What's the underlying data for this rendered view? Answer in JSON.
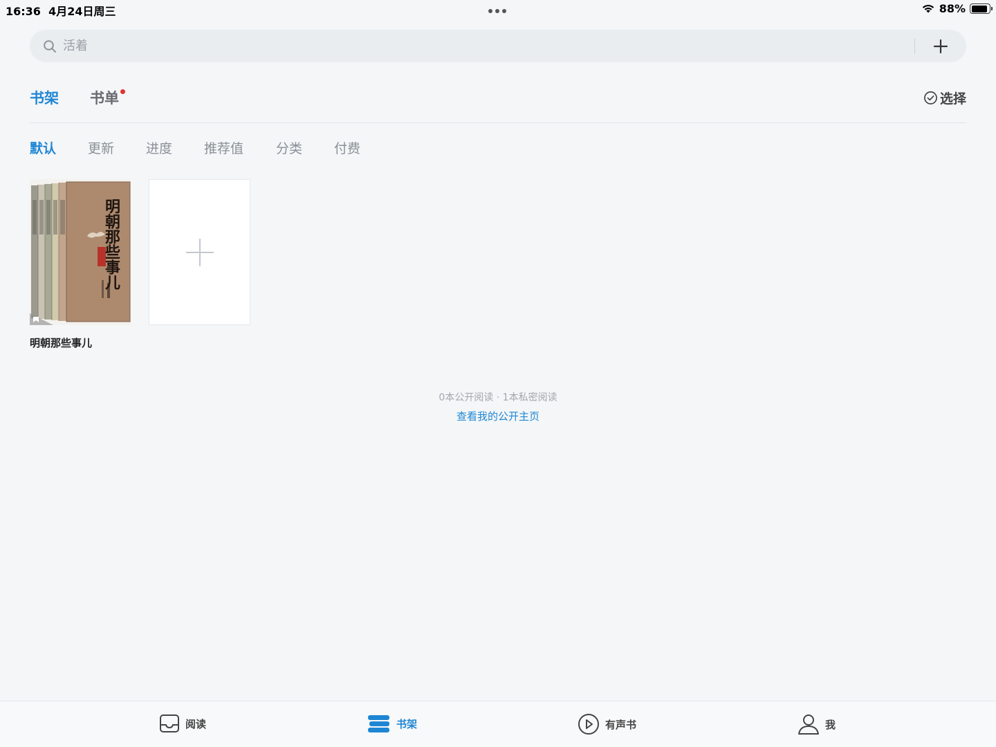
{
  "status_bar": {
    "time": "16:36",
    "date": "4月24日周三",
    "battery": "88%",
    "battery_level": 0.88
  },
  "search": {
    "placeholder": "活着"
  },
  "top_tabs": [
    {
      "label": "书架",
      "active": true
    },
    {
      "label": "书单",
      "active": false,
      "has_dot": true
    }
  ],
  "select_label": "选择",
  "sort_tabs": [
    {
      "label": "默认",
      "active": true
    },
    {
      "label": "更新",
      "active": false
    },
    {
      "label": "进度",
      "active": false
    },
    {
      "label": "推荐值",
      "active": false
    },
    {
      "label": "分类",
      "active": false
    },
    {
      "label": "付费",
      "active": false
    }
  ],
  "books": [
    {
      "title": "明朝那些事儿",
      "cover_text": "明朝那些事儿"
    }
  ],
  "stats": {
    "text": "0本公开阅读 · 1本私密阅读",
    "link": "查看我的公开主页"
  },
  "bottom_nav": [
    {
      "label": "阅读",
      "icon": "inbox-tray-icon",
      "active": false
    },
    {
      "label": "书架",
      "icon": "bookshelf-icon",
      "active": true
    },
    {
      "label": "有声书",
      "icon": "play-circle-icon",
      "active": false
    },
    {
      "label": "我",
      "icon": "person-icon",
      "active": false
    }
  ],
  "colors": {
    "accent": "#1f86d4",
    "background": "#f4f6f8",
    "dot": "#e0342d"
  }
}
